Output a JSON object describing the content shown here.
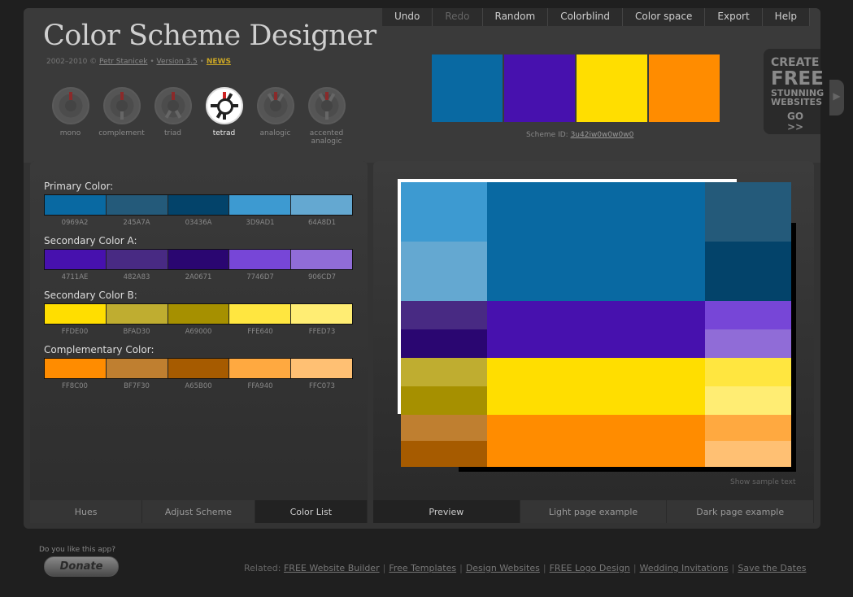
{
  "app": {
    "title": "Color Scheme Designer",
    "credits": {
      "years": "2002–2010 ©",
      "author": "Petr Stanicek",
      "bullet": "•",
      "version": "Version 3.5",
      "news": "NEWS"
    }
  },
  "menu": [
    {
      "label": "Undo",
      "disabled": false
    },
    {
      "label": "Redo",
      "disabled": true
    },
    {
      "label": "Random",
      "disabled": false
    },
    {
      "label": "Colorblind",
      "disabled": false
    },
    {
      "label": "Color space",
      "disabled": false
    },
    {
      "label": "Export",
      "disabled": false
    },
    {
      "label": "Help",
      "disabled": false
    }
  ],
  "scheme_types": [
    {
      "label": "mono",
      "active": false
    },
    {
      "label": "complement",
      "active": false
    },
    {
      "label": "triad",
      "active": false
    },
    {
      "label": "tetrad",
      "active": true
    },
    {
      "label": "analogic",
      "active": false
    },
    {
      "label": "accented analogic",
      "active": false
    }
  ],
  "top_swatches": [
    "#0969A2",
    "#4711AE",
    "#FFDE00",
    "#FF8C00"
  ],
  "scheme_id": {
    "label": "Scheme ID:",
    "value": "3u42iw0w0w0w0"
  },
  "ad": {
    "line1": "CREATE",
    "line2": "FREE",
    "line3a": "STUNNING",
    "line3b": "WEBSITES",
    "cta": "GO >>"
  },
  "color_groups": [
    {
      "title": "Primary Color:",
      "colors": [
        "0969A2",
        "245A7A",
        "03436A",
        "3D9AD1",
        "64A8D1"
      ]
    },
    {
      "title": "Secondary Color A:",
      "colors": [
        "4711AE",
        "482A83",
        "2A0671",
        "7746D7",
        "906CD7"
      ]
    },
    {
      "title": "Secondary Color B:",
      "colors": [
        "FFDE00",
        "BFAD30",
        "A69000",
        "FFE640",
        "FFED73"
      ]
    },
    {
      "title": "Complementary Color:",
      "colors": [
        "FF8C00",
        "BF7F30",
        "A65B00",
        "FFA940",
        "FFC073"
      ]
    }
  ],
  "left_tabs": [
    {
      "label": "Hues",
      "active": false
    },
    {
      "label": "Adjust Scheme",
      "active": false
    },
    {
      "label": "Color List",
      "active": true
    }
  ],
  "right_tabs": [
    {
      "label": "Preview",
      "active": true
    },
    {
      "label": "Light page example",
      "active": false
    },
    {
      "label": "Dark page example",
      "active": false
    }
  ],
  "show_sample_text": "Show sample text",
  "donate": {
    "question": "Do you like this app?",
    "button": "Donate"
  },
  "related": {
    "label": "Related:",
    "links": [
      "FREE Website Builder",
      "Free Templates",
      "Design Websites",
      "FREE Logo Design",
      "Wedding Invitations",
      "Save the Dates"
    ]
  }
}
